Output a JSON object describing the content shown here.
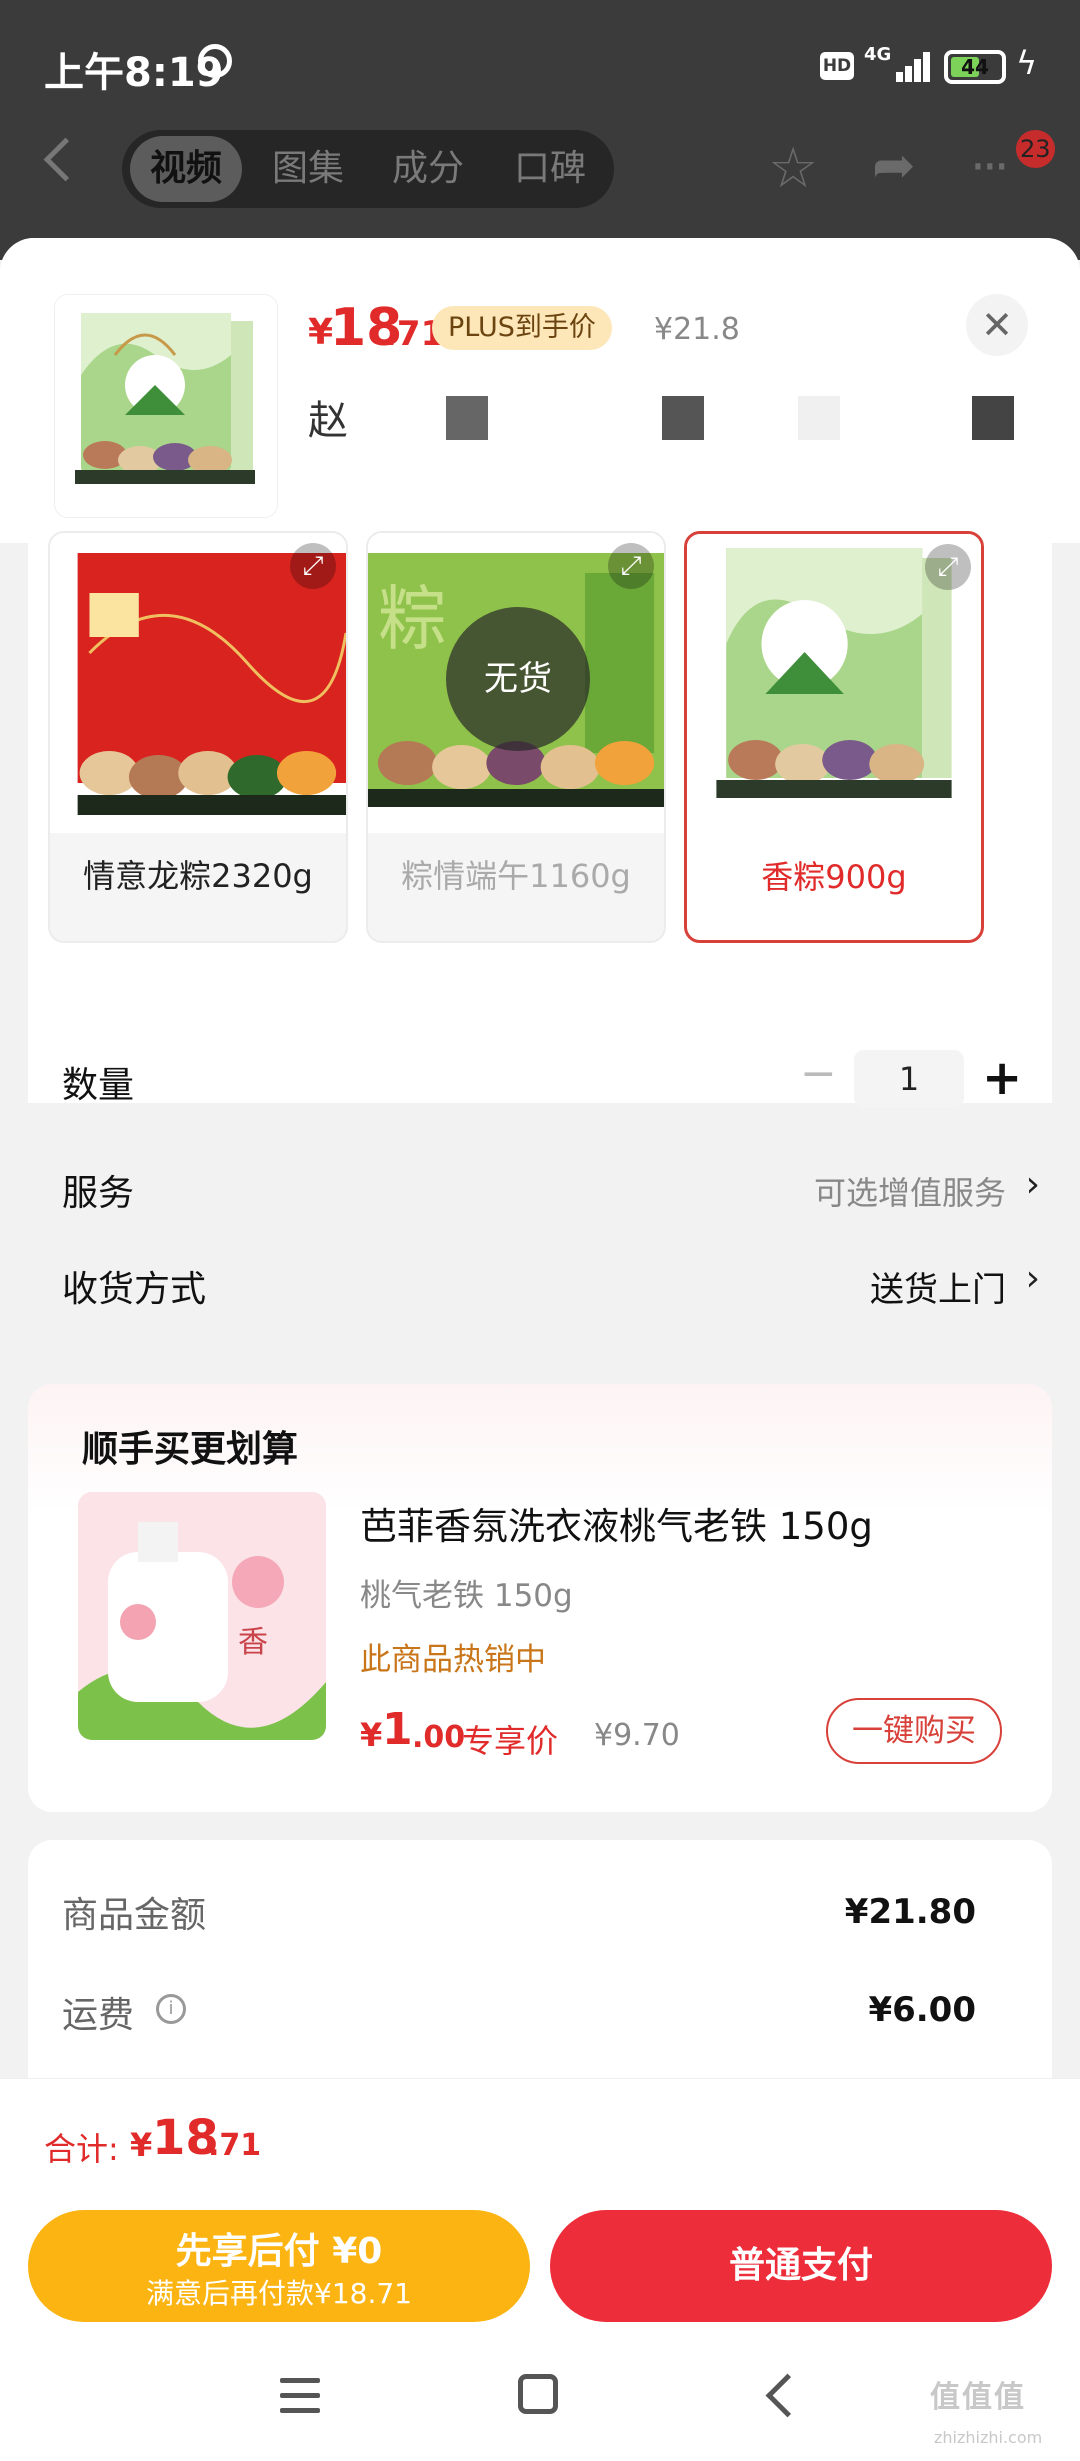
{
  "status_bar": {
    "time": "上午8:19",
    "hd": "HD",
    "network": "4G",
    "battery": "44"
  },
  "nav": {
    "tabs": [
      "视频",
      "图集",
      "成分",
      "口碑"
    ],
    "active_tab": "视频",
    "badge_count": "23"
  },
  "product": {
    "currency": "¥",
    "price_int": "18",
    "price_dec": ".71",
    "plus_tag": "PLUS到手价",
    "original_price": "¥21.8",
    "seller_prefix": "赵"
  },
  "options": [
    {
      "label": "情意龙粽2320g",
      "state": "available"
    },
    {
      "label": "粽情端午1160g",
      "state": "out_of_stock",
      "badge": "无货"
    },
    {
      "label": "香粽900g",
      "state": "selected"
    }
  ],
  "quantity": {
    "label": "数量",
    "value": "1",
    "minus": "−",
    "plus": "+"
  },
  "service": {
    "label": "服务",
    "value": "可选增值服务"
  },
  "delivery": {
    "label": "收货方式",
    "value": "送货上门"
  },
  "upsell": {
    "title": "顺手买更划算",
    "name": "芭菲香氛洗衣液桃气老铁 150g",
    "spec": "桃气老铁 150g",
    "hot": "此商品热销中",
    "currency": "¥",
    "price_int": "1",
    "price_dec": ".00",
    "price_tag": "专享价",
    "original_price": "¥9.70",
    "buy_label": "一键购买"
  },
  "summary": {
    "goods_label": "商品金额",
    "goods_value": "¥21.80",
    "shipping_label": "运费",
    "shipping_value": "¥6.00"
  },
  "total": {
    "label": "合计:",
    "currency": "¥",
    "int": "18",
    "dec": ".71"
  },
  "buttons": {
    "later_main": "先享后付 ¥0",
    "later_sub": "满意后再付款¥18.71",
    "pay": "普通支付"
  },
  "watermark": {
    "text": "值值值",
    "url": "zhizhizhi.com"
  },
  "colors": {
    "accent": "#e12a2a",
    "pay_button": "#ee2d3a",
    "later_button": "#fbb412",
    "plus_tag_bg": "#fde7b8"
  }
}
